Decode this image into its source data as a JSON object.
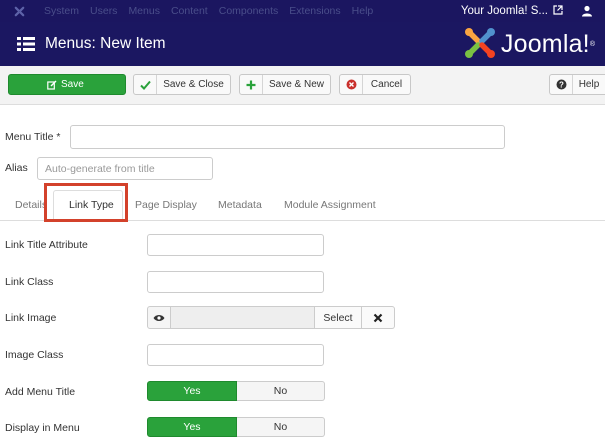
{
  "topnav": {
    "menu_items": [
      "System",
      "Users",
      "Menus",
      "Content",
      "Components",
      "Extensions",
      "Help"
    ],
    "site_link": "Your Joomla! S...",
    "icons": {
      "logo": "joomla-logo-icon",
      "external": "external-link-icon",
      "user": "user-icon"
    }
  },
  "header": {
    "title": "Menus: New Item",
    "brand": "Joomla!",
    "brand_tm": "®"
  },
  "toolbar": {
    "save_label": "Save",
    "save_close_label": "Save & Close",
    "save_new_label": "Save & New",
    "cancel_label": "Cancel",
    "help_label": "Help"
  },
  "form": {
    "menu_title_label": "Menu Title *",
    "menu_title_value": "",
    "alias_label": "Alias",
    "alias_placeholder": "Auto-generate from title"
  },
  "tabs": [
    "Details",
    "Link Type",
    "Page Display",
    "Metadata",
    "Module Assignment"
  ],
  "active_tab": "Link Type",
  "fields": {
    "link_title_attribute": "Link Title Attribute",
    "link_class": "Link Class",
    "link_image": "Link Image",
    "image_select": "Select",
    "image_class": "Image Class",
    "add_menu_title": "Add Menu Title",
    "display_in_menu": "Display in Menu"
  },
  "toggles": {
    "yes": "Yes",
    "no": "No",
    "add_menu_title_value": "Yes",
    "display_in_menu_value": "Yes"
  },
  "colors": {
    "nav_bg": "#1b1660",
    "success": "#2aa23b",
    "highlight": "#d3412b"
  }
}
